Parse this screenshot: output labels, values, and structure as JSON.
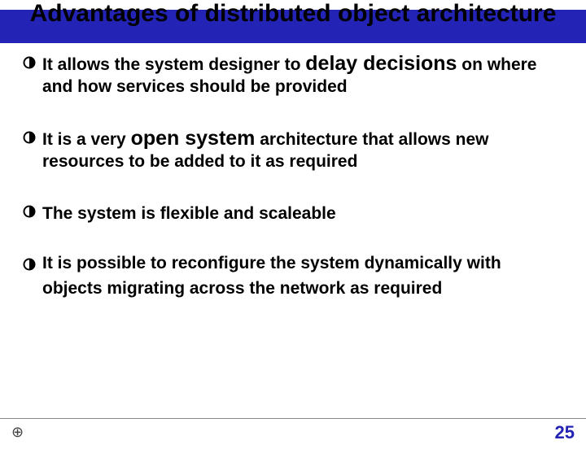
{
  "title": "Advantages of distributed object architecture",
  "bullets": [
    {
      "pre": "It allows the system designer to ",
      "big": "delay decisions",
      "post": " on where and how services should be provided"
    },
    {
      "pre": "It is a very ",
      "big": "open system",
      "post": " architecture that allows new resources to be added to it as required"
    },
    {
      "pre": "The system is flexible and scaleable",
      "big": "",
      "post": ""
    },
    {
      "pre": "It is possible to reconfigure the system dynamically with objects migrating across the network as required",
      "big": "",
      "post": ""
    }
  ],
  "footer": {
    "icon": "⊕",
    "page": "25"
  }
}
